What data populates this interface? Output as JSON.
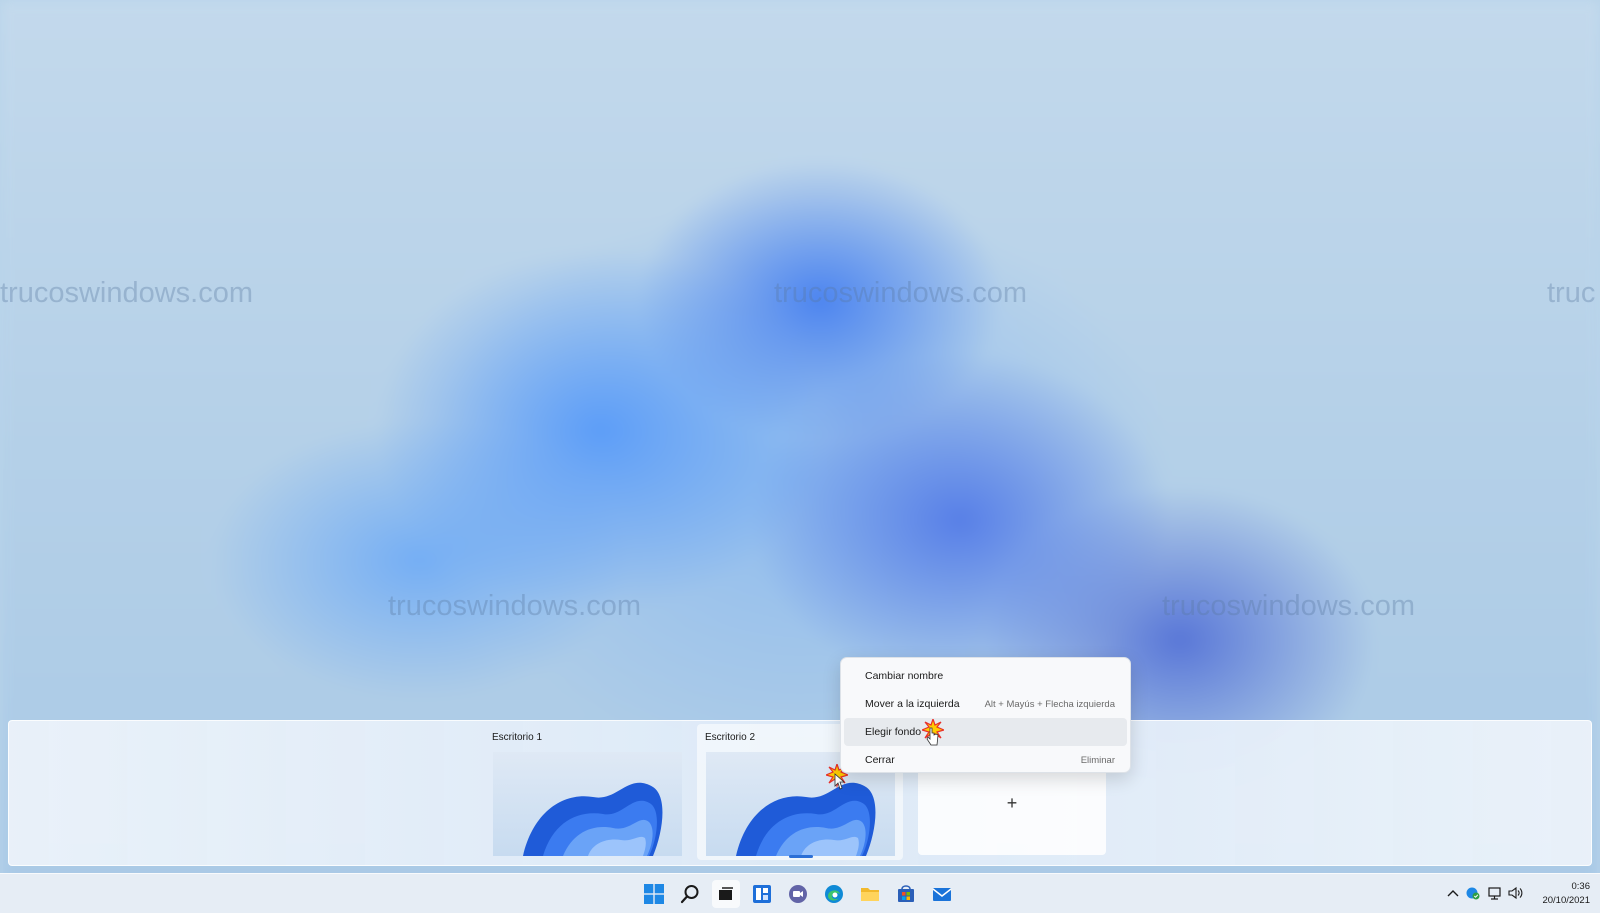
{
  "watermark": {
    "text": "trucoswindows.com",
    "partial": "truc"
  },
  "desktops": [
    {
      "label": "Escritorio 1",
      "active": false
    },
    {
      "label": "Escritorio 2",
      "active": true
    }
  ],
  "new_desktop": {
    "label": "+"
  },
  "context_menu": {
    "items": [
      {
        "label": "Cambiar nombre",
        "shortcut": ""
      },
      {
        "label": "Mover a la izquierda",
        "shortcut": "Alt + Mayús + Flecha izquierda"
      },
      {
        "label": "Elegir fondo",
        "shortcut": "",
        "hover": true
      },
      {
        "label": "Cerrar",
        "shortcut": "Eliminar"
      }
    ]
  },
  "taskbar": {
    "icons": [
      "start-icon",
      "search-icon",
      "task-view-icon",
      "widgets-icon",
      "chat-icon",
      "edge-icon",
      "file-explorer-icon",
      "store-icon",
      "mail-icon"
    ],
    "tray_icons": [
      "chevron-up-icon",
      "security-icon",
      "network-icon",
      "volume-icon"
    ],
    "clock": {
      "time": "0:36",
      "date": "20/10/2021"
    }
  },
  "colors": {
    "accent": "#2b6fd6",
    "menu_hover": "#e7eaee"
  }
}
